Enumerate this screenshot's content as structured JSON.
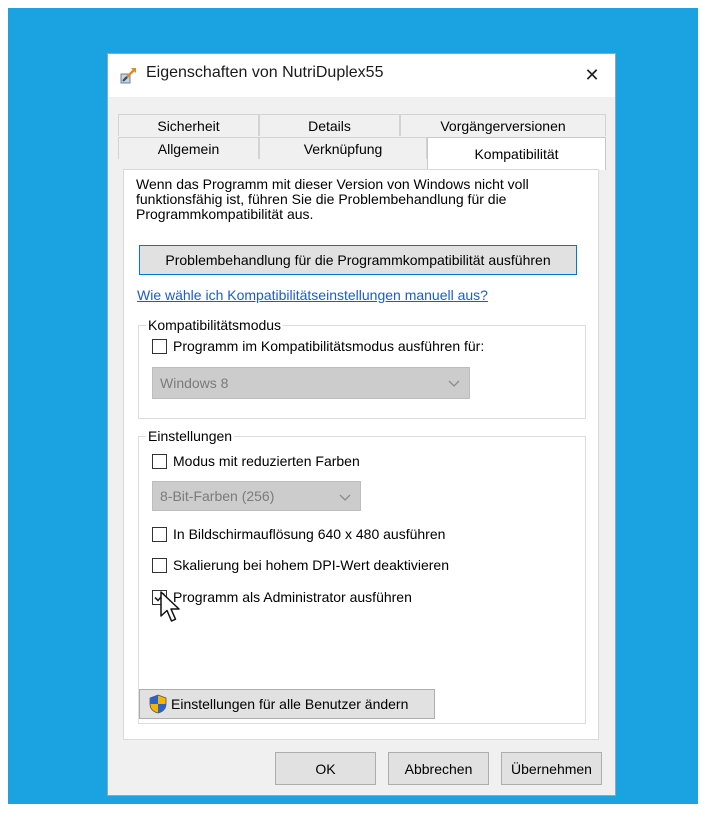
{
  "window": {
    "title": "Eigenschaften von NutriDuplex55",
    "close_glyph": "✕"
  },
  "tabs": {
    "row1": [
      {
        "label": "Sicherheit"
      },
      {
        "label": "Details"
      },
      {
        "label": "Vorgängerversionen"
      }
    ],
    "row2": [
      {
        "label": "Allgemein"
      },
      {
        "label": "Verknüpfung"
      },
      {
        "label": "Kompatibilität",
        "active": true
      }
    ]
  },
  "panel": {
    "description": "Wenn das Programm mit dieser Version von Windows nicht voll\nfunktionsfähig ist, führen Sie die Problembehandlung für die\nProgrammkompatibilität aus.",
    "troubleshoot_button": "Problembehandlung für die Programmkompatibilität ausführen",
    "manual_link": "Wie wähle ich Kompatibilitätseinstellungen manuell aus?",
    "compat_mode": {
      "group_label": "Kompatibilitätsmodus",
      "checkbox_label": "Programm im Kompatibilitätsmodus ausführen für:",
      "checked": false,
      "select_value": "Windows 8"
    },
    "settings": {
      "group_label": "Einstellungen",
      "reduced_colors_label": "Modus mit reduzierten Farben",
      "reduced_colors_checked": false,
      "color_select_value": "8-Bit-Farben (256)",
      "resolution_label": "In Bildschirmauflösung 640 x 480 ausführen",
      "resolution_checked": false,
      "dpi_label": "Skalierung bei hohem DPI-Wert deaktivieren",
      "dpi_checked": false,
      "admin_label": "Programm als Administrator ausführen",
      "admin_checked": true
    },
    "all_users_button": "Einstellungen für alle Benutzer ändern"
  },
  "footer": {
    "ok": "OK",
    "cancel": "Abbrechen",
    "apply": "Übernehmen"
  },
  "colors": {
    "desktop": "#1aa3e0",
    "dialog": "#f0f0f0",
    "accent": "#0078d7",
    "link": "#1a5ccc"
  }
}
